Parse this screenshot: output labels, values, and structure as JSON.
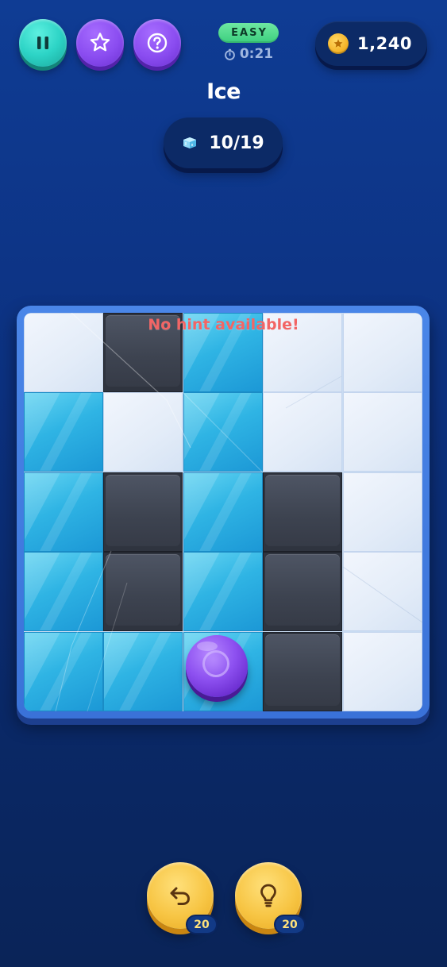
{
  "top_bar": {
    "pause_icon": "pause-icon",
    "star_icon": "star-icon",
    "help_icon": "question-icon",
    "difficulty": "EASY",
    "timer": "0:21",
    "timer_icon": "stopwatch-icon",
    "coins": "1,240",
    "coin_icon": "coin-star-icon"
  },
  "level": {
    "title": "Ice",
    "progress": "10/19",
    "progress_icon": "ice-cube-icon"
  },
  "board": {
    "rows": 5,
    "cols": 5,
    "grid": [
      [
        "snow",
        "wall",
        "ice",
        "snow",
        "snow"
      ],
      [
        "ice",
        "snow",
        "ice",
        "snow",
        "snow"
      ],
      [
        "ice",
        "wall",
        "ice",
        "wall",
        "snow"
      ],
      [
        "ice",
        "wall",
        "ice",
        "wall",
        "snow"
      ],
      [
        "ice",
        "ice",
        "ice",
        "wall",
        "snow"
      ]
    ],
    "ball_cell": [
      4,
      2
    ],
    "hint_message": "No hint available!",
    "colors": {
      "ice": "#2fb4e4",
      "snow": "#e6eef9",
      "wall": "#3d4350",
      "ball": "#8d50f0",
      "hint_text": "#f26565"
    }
  },
  "controls": {
    "undo_icon": "undo-arrow-icon",
    "undo_count": "20",
    "hint_icon": "lightbulb-icon",
    "hint_count": "20"
  }
}
